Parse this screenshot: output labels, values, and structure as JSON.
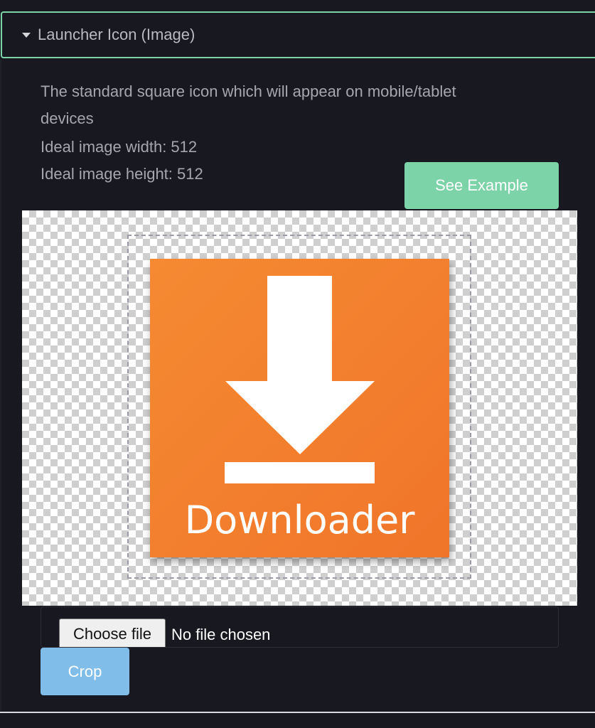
{
  "accordion": {
    "title": "Launcher Icon (Image)",
    "expanded_icon": "caret-down-icon",
    "accent_color": "#7dd3a8"
  },
  "description": {
    "line1": "The standard square icon which will appear on mobile/tablet",
    "line2": "devices",
    "width_text": "Ideal image width: 512",
    "height_text": "Ideal image height: 512"
  },
  "example_button": {
    "label": "See Example",
    "color": "#7dd3a8"
  },
  "preview": {
    "logo_text": "Downloader",
    "logo_color": "#f0752a",
    "logo_icon": "download-arrow-icon"
  },
  "file_input": {
    "button_label": "Choose file",
    "status": "No file chosen"
  },
  "crop_button": {
    "label": "Crop",
    "color": "#80bde9"
  }
}
